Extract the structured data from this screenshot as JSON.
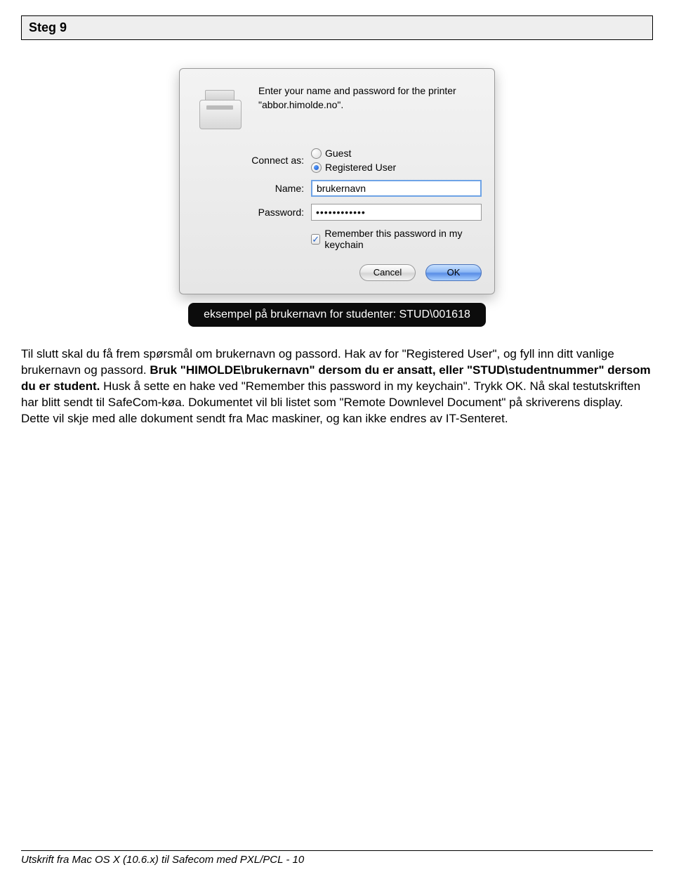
{
  "stepHeader": "Steg 9",
  "dialog": {
    "prompt": "Enter your name and password for the printer \"abbor.himolde.no\".",
    "connectLabel": "Connect as:",
    "guest": "Guest",
    "registered": "Registered User",
    "nameLabel": "Name:",
    "nameValue": "brukernavn",
    "passwordLabel": "Password:",
    "passwordMask": "••••••••••••",
    "remember": "Remember this password in my keychain",
    "cancel": "Cancel",
    "ok": "OK"
  },
  "caption": "eksempel på brukernavn for studenter: STUD\\001618",
  "body": {
    "p1a": "Til slutt skal du få frem spørsmål om brukernavn og passord. Hak av for \"Registered User\", og fyll inn ditt vanlige brukernavn og passord. ",
    "p1b": "Bruk \"HIMOLDE\\brukernavn\" dersom du er ansatt, eller \"STUD\\studentnummer\" dersom du er student.",
    "p1c": " Husk å sette en hake ved \"Remember this password in my keychain\". Trykk OK. Nå skal testutskriften har blitt sendt til SafeCom-køa. Dokumentet vil bli listet som \"Remote Downlevel Document\" på skriverens display. Dette vil skje med alle dokument sendt fra Mac maskiner, og kan ikke endres av IT-Senteret."
  },
  "footer": "Utskrift fra Mac OS X (10.6.x) til Safecom med PXL/PCL - 10"
}
